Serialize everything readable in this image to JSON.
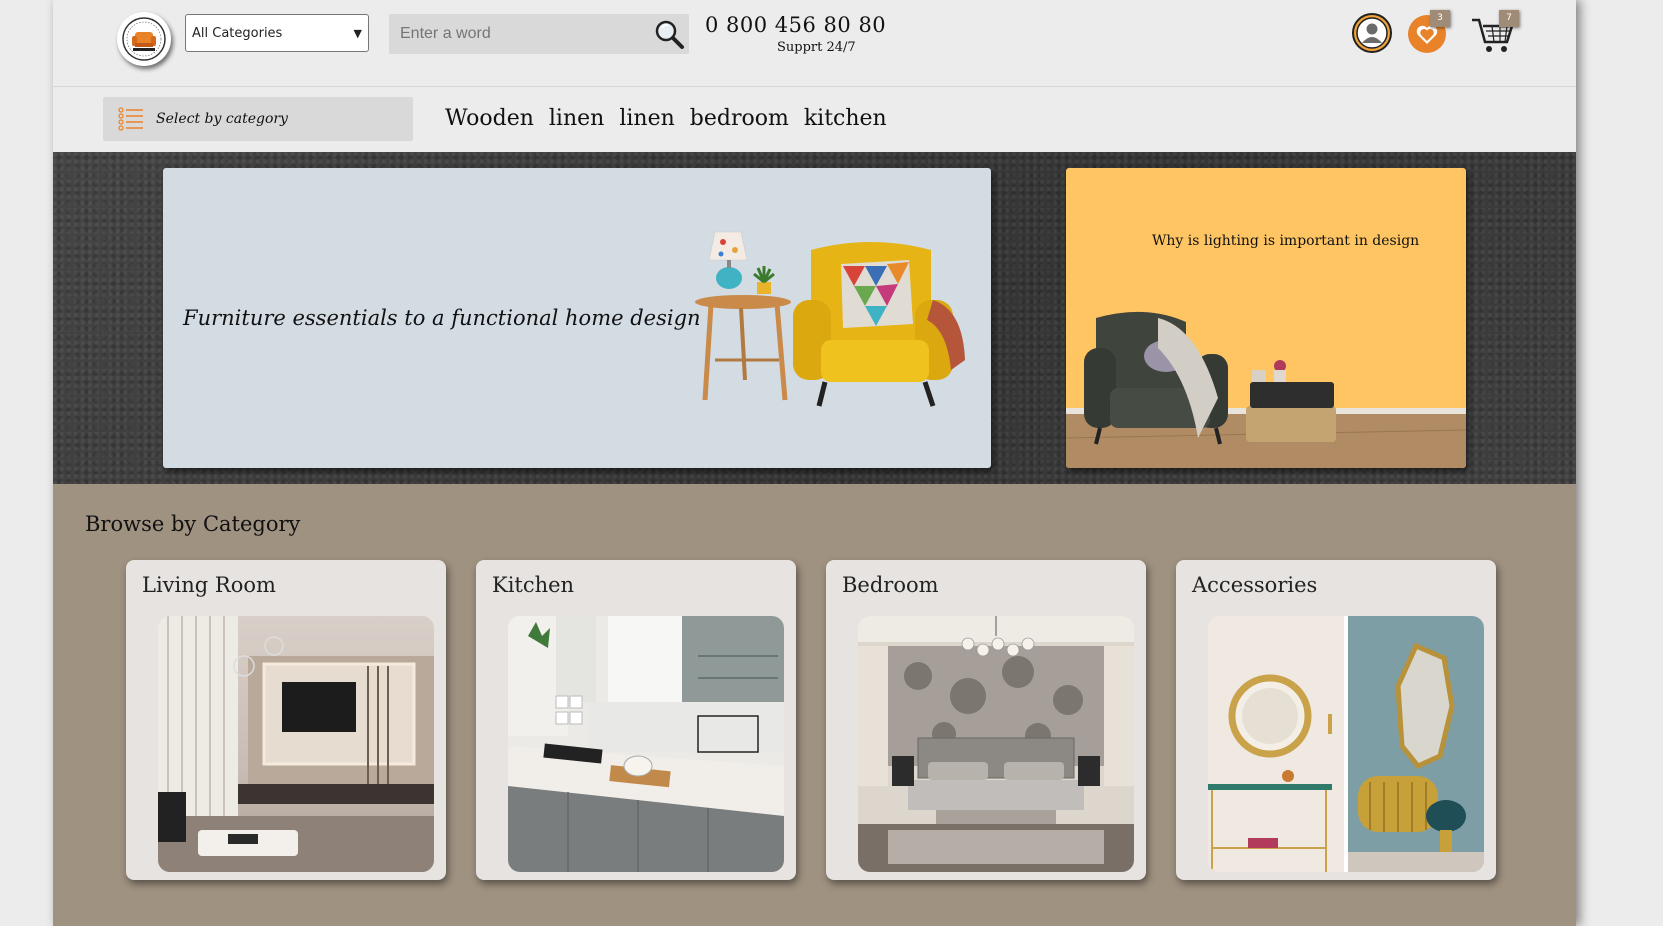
{
  "header": {
    "category_select": "All Categories",
    "search_placeholder": "Enter a word",
    "phone": "0 800 456 80 80",
    "support": "Supprt 24/7",
    "wishlist_count": "3",
    "cart_count": "7"
  },
  "nav": {
    "category_button": "Select by category",
    "menu": [
      "Wooden",
      "linen",
      "linen",
      "bedroom",
      "kitchen"
    ]
  },
  "hero": {
    "banner_main": "Furniture essentials to a functional home design",
    "banner_side": "Why is lighting is important in design"
  },
  "browse": {
    "title": "Browse by Category",
    "categories": [
      "Living Room",
      "Kitchen",
      "Bedroom",
      "Accessories"
    ]
  },
  "colors": {
    "header_bg": "#ececec",
    "hero_bg": "#3f3f3f",
    "banner_main_bg": "#d3dbe3",
    "banner_side_bg": "#fec562",
    "browse_bg": "#a09281",
    "card_bg": "#e7e3e1",
    "accent_orange": "#e9832a"
  }
}
